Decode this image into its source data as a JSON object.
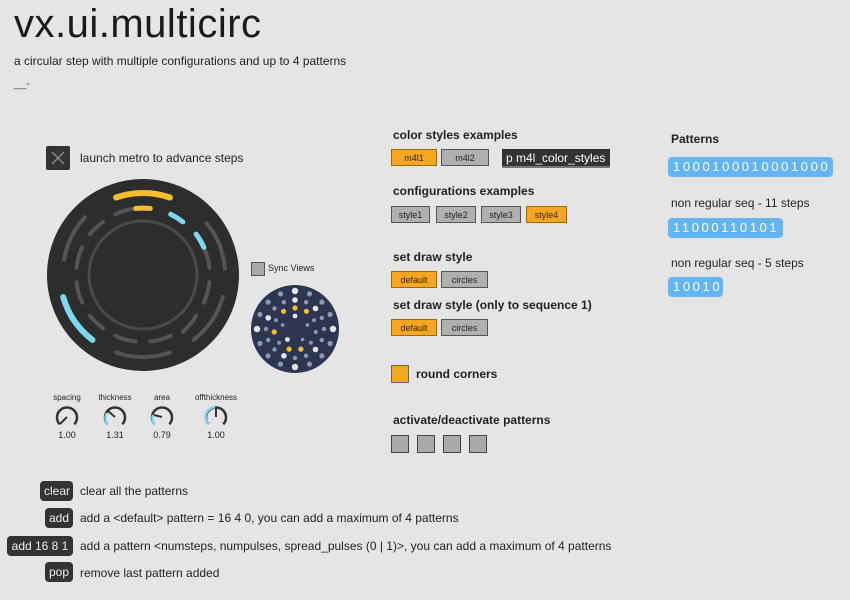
{
  "header": {
    "title": "vx.ui.multicirc",
    "subtitle": "a circular step with multiple configurations and up to 4 patterns",
    "dash": "__-"
  },
  "metro": {
    "label": "launch metro to advance steps"
  },
  "sync": {
    "label": "Sync Views"
  },
  "knobs": [
    {
      "label": "spacing",
      "value": "1.00"
    },
    {
      "label": "thickness",
      "value": "1.31"
    },
    {
      "label": "area",
      "value": "0.79"
    },
    {
      "label": "offthickness",
      "value": "1.00"
    }
  ],
  "color_styles": {
    "heading": "color styles examples",
    "buttons": [
      "m4l1",
      "m4l2"
    ],
    "subpatcher": "p m4l_color_styles"
  },
  "configurations": {
    "heading": "configurations examples",
    "buttons": [
      "style1",
      "style2",
      "style3",
      "style4"
    ]
  },
  "draw_style": {
    "heading": "set draw style",
    "buttons": [
      "default",
      "circles"
    ]
  },
  "draw_style_seq1": {
    "heading": "set draw style (only to sequence 1)",
    "buttons": [
      "default",
      "circles"
    ]
  },
  "round_corners": {
    "label": "round corners"
  },
  "activate": {
    "heading": "activate/deactivate patterns"
  },
  "patterns": {
    "heading": "Patterns",
    "p1": "1000100010001000",
    "label2": "non regular seq - 11 steps",
    "p2": "11000110101",
    "label3": "non regular seq - 5 steps",
    "p3": "10010"
  },
  "actions": [
    {
      "button": "clear",
      "desc": "clear all the patterns"
    },
    {
      "button": "add",
      "desc": "add a <default> pattern = 16 4 0, you can add a maximum of 4 patterns"
    },
    {
      "button": "add 16 8 1",
      "desc": "add a pattern <numsteps, numpulses, spread_pulses (0 | 1)>, you can add a maximum of 4 patterns"
    },
    {
      "button": "pop",
      "desc": "remove last pattern added"
    }
  ],
  "colors": {
    "accent": "#f5a623",
    "cyan": "#7fd8ee",
    "yellow": "#f7bd2e",
    "pattern": "#64b5f6",
    "dark": "#2d2d2d"
  }
}
